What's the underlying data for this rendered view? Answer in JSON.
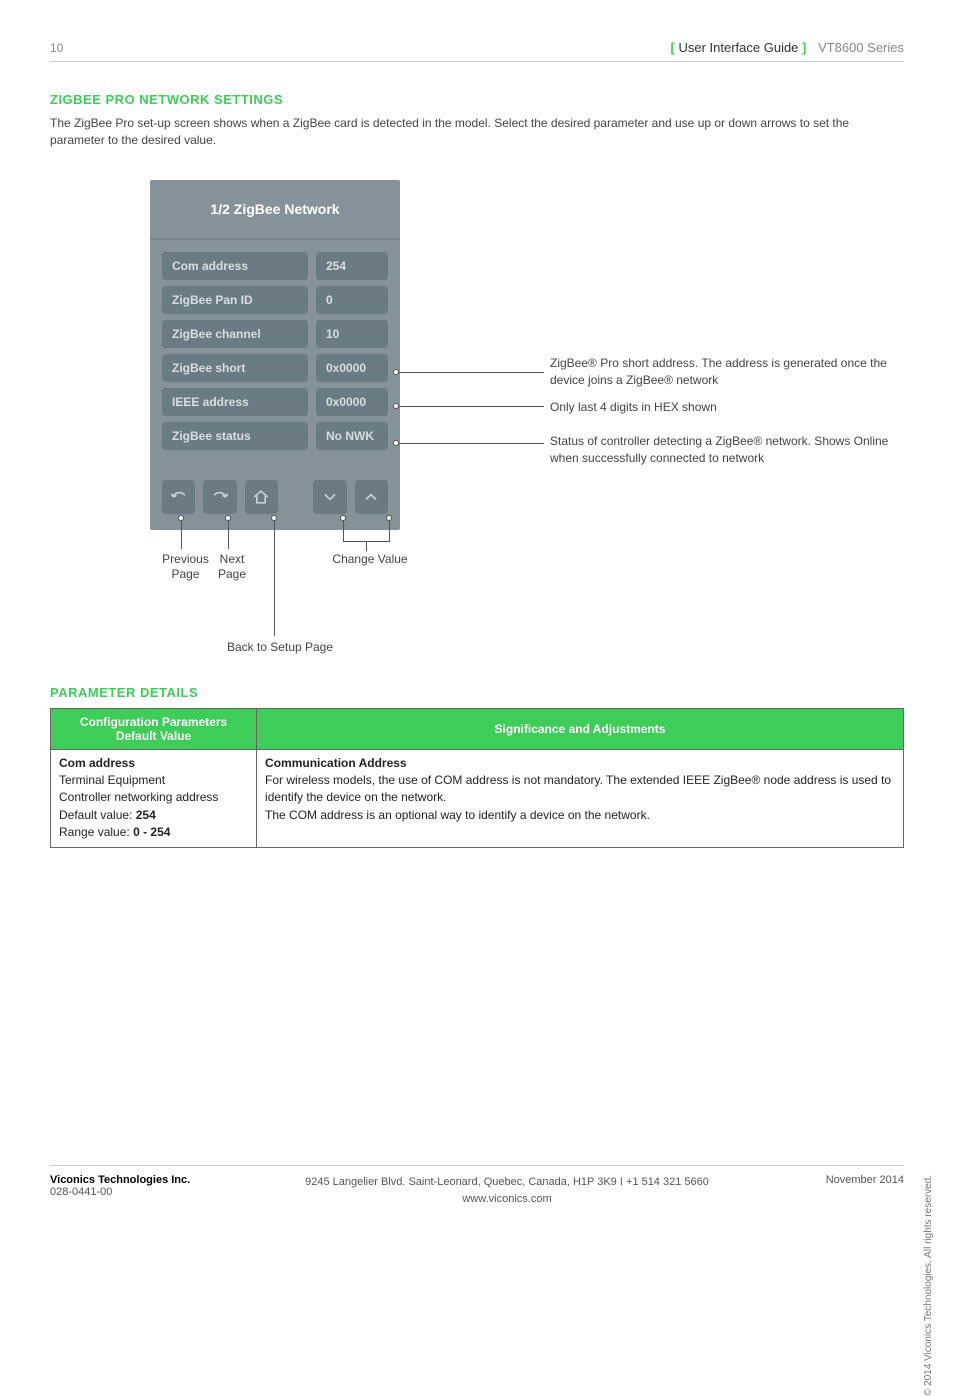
{
  "header": {
    "page_number": "10",
    "guide_label": "User Interface Guide",
    "series": "VT8600 Series"
  },
  "section1": {
    "title": "ZIGBEE PRO NETWORK SETTINGS",
    "intro": "The ZigBee Pro set-up screen shows when a ZigBee card is detected in the model. Select the desired parameter and use up or down arrows to set the parameter to the desired value."
  },
  "device": {
    "title": "1/2 ZigBee Network",
    "rows": [
      {
        "label": "Com address",
        "value": "254"
      },
      {
        "label": "ZigBee Pan ID",
        "value": "0"
      },
      {
        "label": "ZigBee channel",
        "value": "10"
      },
      {
        "label": "ZigBee short",
        "value": "0x0000"
      },
      {
        "label": "IEEE address",
        "value": "0x0000"
      },
      {
        "label": "ZigBee status",
        "value": "No NWK"
      }
    ]
  },
  "callouts": {
    "short": "ZigBee® Pro short address. The address is generated once the device joins a ZigBee® network",
    "ieee": "Only last 4 digits in HEX shown",
    "status": "Status of controller detecting a ZigBee® network. Shows Online when successfully connected to network"
  },
  "button_labels": {
    "prev": "Previous Page",
    "next": "Next Page",
    "home": "Back to Setup Page",
    "change": "Change Value"
  },
  "section2_title": "PARAMETER DETAILS",
  "table": {
    "headers": {
      "left": "Configuration Parameters Default Value",
      "right": "Significance and Adjustments"
    },
    "row": {
      "left_title": "Com address",
      "left_lines": [
        "Terminal Equipment",
        "Controller networking address"
      ],
      "left_default_label": "Default value: ",
      "left_default_value": "254",
      "left_range_label": "Range value: ",
      "left_range_value": "0 - 254",
      "right_title": "Communication Address",
      "right_body": "For wireless models, the use of COM address is not mandatory. The extended IEEE ZigBee® node address is used to identify the device on the network.\nThe COM address is an optional way to identify a device on the network."
    }
  },
  "footer": {
    "company": "Viconics Technologies Inc.",
    "doc_no": "028-0441-00",
    "address_line": "9245 Langelier Blvd. Saint-Leonard, Quebec, Canada, H1P 3K9   I   +1 514 321 5660",
    "url": "www.viconics.com",
    "date": "November 2014",
    "copyright": "© 2014 Viconics Technologies. All rights reserved."
  }
}
